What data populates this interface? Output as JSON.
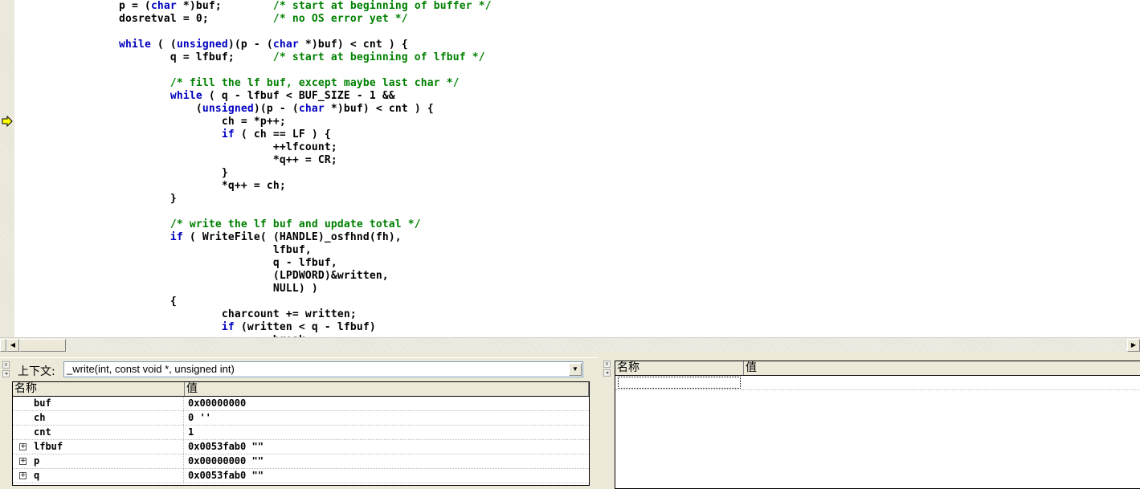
{
  "editor": {
    "current_line": 9,
    "lines": [
      "                p = (char *)buf;        /* start at beginning of buffer */",
      "                dosretval = 0;          /* no OS error yet */",
      "",
      "                while ( (unsigned)(p - (char *)buf) < cnt ) {",
      "                        q = lfbuf;      /* start at beginning of lfbuf */",
      "",
      "                        /* fill the lf buf, except maybe last char */",
      "                        while ( q - lfbuf < BUF_SIZE - 1 &&",
      "                            (unsigned)(p - (char *)buf) < cnt ) {",
      "                                ch = *p++;",
      "                                if ( ch == LF ) {",
      "                                        ++lfcount;",
      "                                        *q++ = CR;",
      "                                }",
      "                                *q++ = ch;",
      "                        }",
      "",
      "                        /* write the lf buf and update total */",
      "                        if ( WriteFile( (HANDLE)_osfhnd(fh),",
      "                                        lfbuf,",
      "                                        q - lfbuf,",
      "                                        (LPDWORD)&written,",
      "                                        NULL) )",
      "                        {",
      "                                charcount += written;",
      "                                if (written < q - lfbuf)",
      "                                        break;"
    ],
    "keyword_color": "#0000c0",
    "comment_color": "#008000"
  },
  "locals": {
    "context_label": "上下文:",
    "context_value": "_write(int, const void *, unsigned int)",
    "col_name": "名称",
    "col_value": "值",
    "rows": [
      {
        "name": "buf",
        "value": "0x00000000",
        "expandable": false
      },
      {
        "name": "ch",
        "value": "0 ''",
        "expandable": false
      },
      {
        "name": "cnt",
        "value": "1",
        "expandable": false
      },
      {
        "name": "lfbuf",
        "value": "0x0053fab0 \"\"",
        "expandable": true
      },
      {
        "name": "p",
        "value": "0x00000000 \"\"",
        "expandable": true
      },
      {
        "name": "q",
        "value": "0x0053fab0 \"\"",
        "expandable": true
      }
    ]
  },
  "watch": {
    "col_name": "名称",
    "col_value": "值"
  }
}
